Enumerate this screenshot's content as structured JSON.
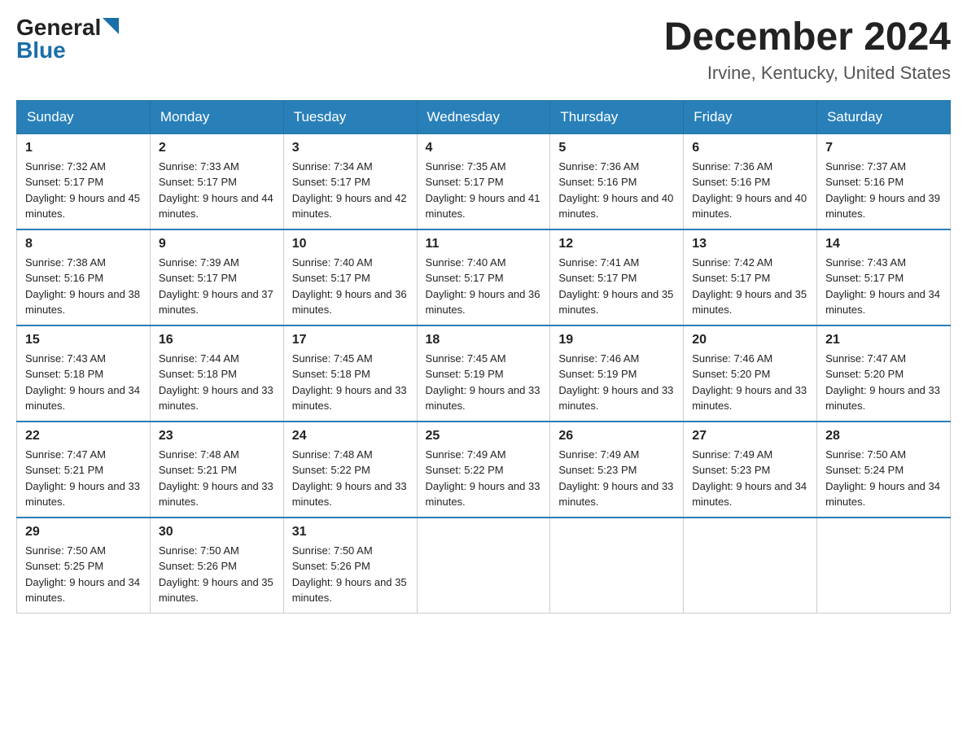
{
  "logo": {
    "general": "General",
    "blue": "Blue"
  },
  "title": {
    "month_year": "December 2024",
    "location": "Irvine, Kentucky, United States"
  },
  "weekdays": [
    "Sunday",
    "Monday",
    "Tuesday",
    "Wednesday",
    "Thursday",
    "Friday",
    "Saturday"
  ],
  "weeks": [
    [
      {
        "day": "1",
        "sunrise": "7:32 AM",
        "sunset": "5:17 PM",
        "daylight": "9 hours and 45 minutes."
      },
      {
        "day": "2",
        "sunrise": "7:33 AM",
        "sunset": "5:17 PM",
        "daylight": "9 hours and 44 minutes."
      },
      {
        "day": "3",
        "sunrise": "7:34 AM",
        "sunset": "5:17 PM",
        "daylight": "9 hours and 42 minutes."
      },
      {
        "day": "4",
        "sunrise": "7:35 AM",
        "sunset": "5:17 PM",
        "daylight": "9 hours and 41 minutes."
      },
      {
        "day": "5",
        "sunrise": "7:36 AM",
        "sunset": "5:16 PM",
        "daylight": "9 hours and 40 minutes."
      },
      {
        "day": "6",
        "sunrise": "7:36 AM",
        "sunset": "5:16 PM",
        "daylight": "9 hours and 40 minutes."
      },
      {
        "day": "7",
        "sunrise": "7:37 AM",
        "sunset": "5:16 PM",
        "daylight": "9 hours and 39 minutes."
      }
    ],
    [
      {
        "day": "8",
        "sunrise": "7:38 AM",
        "sunset": "5:16 PM",
        "daylight": "9 hours and 38 minutes."
      },
      {
        "day": "9",
        "sunrise": "7:39 AM",
        "sunset": "5:17 PM",
        "daylight": "9 hours and 37 minutes."
      },
      {
        "day": "10",
        "sunrise": "7:40 AM",
        "sunset": "5:17 PM",
        "daylight": "9 hours and 36 minutes."
      },
      {
        "day": "11",
        "sunrise": "7:40 AM",
        "sunset": "5:17 PM",
        "daylight": "9 hours and 36 minutes."
      },
      {
        "day": "12",
        "sunrise": "7:41 AM",
        "sunset": "5:17 PM",
        "daylight": "9 hours and 35 minutes."
      },
      {
        "day": "13",
        "sunrise": "7:42 AM",
        "sunset": "5:17 PM",
        "daylight": "9 hours and 35 minutes."
      },
      {
        "day": "14",
        "sunrise": "7:43 AM",
        "sunset": "5:17 PM",
        "daylight": "9 hours and 34 minutes."
      }
    ],
    [
      {
        "day": "15",
        "sunrise": "7:43 AM",
        "sunset": "5:18 PM",
        "daylight": "9 hours and 34 minutes."
      },
      {
        "day": "16",
        "sunrise": "7:44 AM",
        "sunset": "5:18 PM",
        "daylight": "9 hours and 33 minutes."
      },
      {
        "day": "17",
        "sunrise": "7:45 AM",
        "sunset": "5:18 PM",
        "daylight": "9 hours and 33 minutes."
      },
      {
        "day": "18",
        "sunrise": "7:45 AM",
        "sunset": "5:19 PM",
        "daylight": "9 hours and 33 minutes."
      },
      {
        "day": "19",
        "sunrise": "7:46 AM",
        "sunset": "5:19 PM",
        "daylight": "9 hours and 33 minutes."
      },
      {
        "day": "20",
        "sunrise": "7:46 AM",
        "sunset": "5:20 PM",
        "daylight": "9 hours and 33 minutes."
      },
      {
        "day": "21",
        "sunrise": "7:47 AM",
        "sunset": "5:20 PM",
        "daylight": "9 hours and 33 minutes."
      }
    ],
    [
      {
        "day": "22",
        "sunrise": "7:47 AM",
        "sunset": "5:21 PM",
        "daylight": "9 hours and 33 minutes."
      },
      {
        "day": "23",
        "sunrise": "7:48 AM",
        "sunset": "5:21 PM",
        "daylight": "9 hours and 33 minutes."
      },
      {
        "day": "24",
        "sunrise": "7:48 AM",
        "sunset": "5:22 PM",
        "daylight": "9 hours and 33 minutes."
      },
      {
        "day": "25",
        "sunrise": "7:49 AM",
        "sunset": "5:22 PM",
        "daylight": "9 hours and 33 minutes."
      },
      {
        "day": "26",
        "sunrise": "7:49 AM",
        "sunset": "5:23 PM",
        "daylight": "9 hours and 33 minutes."
      },
      {
        "day": "27",
        "sunrise": "7:49 AM",
        "sunset": "5:23 PM",
        "daylight": "9 hours and 34 minutes."
      },
      {
        "day": "28",
        "sunrise": "7:50 AM",
        "sunset": "5:24 PM",
        "daylight": "9 hours and 34 minutes."
      }
    ],
    [
      {
        "day": "29",
        "sunrise": "7:50 AM",
        "sunset": "5:25 PM",
        "daylight": "9 hours and 34 minutes."
      },
      {
        "day": "30",
        "sunrise": "7:50 AM",
        "sunset": "5:26 PM",
        "daylight": "9 hours and 35 minutes."
      },
      {
        "day": "31",
        "sunrise": "7:50 AM",
        "sunset": "5:26 PM",
        "daylight": "9 hours and 35 minutes."
      },
      null,
      null,
      null,
      null
    ]
  ]
}
